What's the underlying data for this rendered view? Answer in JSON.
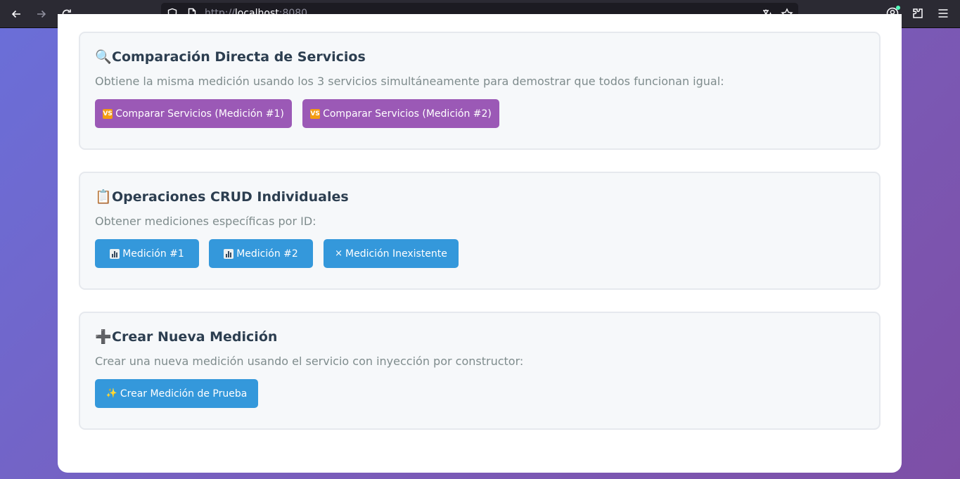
{
  "browser": {
    "url_scheme": "http://",
    "url_host": "localhost",
    "url_port": ":8080",
    "icons": [
      "back-icon",
      "forward-icon",
      "reload-icon",
      "shield-icon",
      "page-icon",
      "translate-icon",
      "star-icon",
      "account-icon",
      "extensions-icon",
      "menu-icon"
    ]
  },
  "sections": {
    "compare": {
      "emoji": "🔍",
      "title": "Comparación Directa de Servicios",
      "description": "Obtiene la misma medición usando los 3 servicios simultáneamente para demostrar que todos funcionan igual:",
      "button1": "Comparar Servicios (Medición #1)",
      "button2": "Comparar Servicios (Medición #2)",
      "vs_label": "VS"
    },
    "crud": {
      "emoji": "📋",
      "title": "Operaciones CRUD Individuales",
      "description": "Obtener mediciones específicas por ID:",
      "button1": "Medición #1",
      "button2": "Medición #2",
      "button3": "Medición Inexistente",
      "x_glyph": "×"
    },
    "create": {
      "emoji": "➕",
      "title": "Crear Nueva Medición",
      "description": "Crear una nueva medición usando el servicio con inyección por constructor:",
      "button1": "Crear Medición de Prueba",
      "sparkle_glyph": "✨"
    }
  },
  "colors": {
    "purple_button": "#9b59b6",
    "blue_button": "#3498db",
    "title": "#2c3e50",
    "description": "#7f8c8d"
  }
}
